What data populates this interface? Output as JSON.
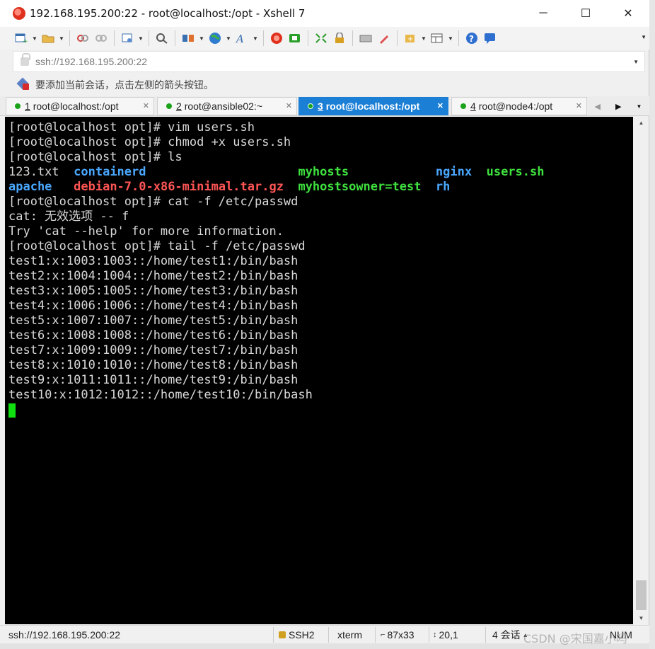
{
  "window": {
    "title": "192.168.195.200:22 - root@localhost:/opt - Xshell 7",
    "controls": {
      "minimize": "─",
      "maximize": "☐",
      "close": "✕"
    }
  },
  "toolbar": {
    "icons": [
      "new-session-icon",
      "open-folder-icon",
      "disconnect-icon",
      "reconnect-icon",
      "properties-icon",
      "find-icon",
      "transfer-icon",
      "globe-icon",
      "font-icon",
      "xshell-icon",
      "xftp-icon",
      "fullscreen-icon",
      "lock-icon",
      "keyboard-icon",
      "highlight-icon",
      "add-icon",
      "layout-icon",
      "help-icon",
      "chat-icon"
    ]
  },
  "address_bar": {
    "value": "ssh://192.168.195.200:22"
  },
  "hint_bar": {
    "text": "要添加当前会话，点击左侧的箭头按钮。"
  },
  "tabs": [
    {
      "number": "1",
      "label": "root@localhost:/opt",
      "active": false
    },
    {
      "number": "2",
      "label": "root@ansible02:~",
      "active": false
    },
    {
      "number": "3",
      "label": "root@localhost:/opt",
      "active": true
    },
    {
      "number": "4",
      "label": "root@node4:/opt",
      "active": false
    }
  ],
  "terminal": {
    "lines": [
      "[root@localhost opt]# vim users.sh",
      "[root@localhost opt]# chmod +x users.sh",
      "[root@localhost opt]# ls"
    ],
    "ls_row1": {
      "c1": "123.txt",
      "c2": "containerd",
      "c3": "myhosts",
      "c4": "nginx",
      "c5": "users.sh"
    },
    "ls_row2": {
      "c1": "apache",
      "c2": "debian-7.0-x86-minimal.tar.gz",
      "c3": "myhostsowner=test",
      "c4": "rh"
    },
    "lines2": [
      "[root@localhost opt]# cat -f /etc/passwd",
      "cat: 无效选项 -- f",
      "Try 'cat --help' for more information.",
      "[root@localhost opt]# tail -f /etc/passwd",
      "test1:x:1003:1003::/home/test1:/bin/bash",
      "test2:x:1004:1004::/home/test2:/bin/bash",
      "test3:x:1005:1005::/home/test3:/bin/bash",
      "test4:x:1006:1006::/home/test4:/bin/bash",
      "test5:x:1007:1007::/home/test5:/bin/bash",
      "test6:x:1008:1008::/home/test6:/bin/bash",
      "test7:x:1009:1009::/home/test7:/bin/bash",
      "test8:x:1010:1010::/home/test8:/bin/bash",
      "test9:x:1011:1011::/home/test9:/bin/bash",
      "test10:x:1012:1012::/home/test10:/bin/bash"
    ],
    "colors": {
      "directory": "#4aa8ff",
      "archive": "#ff5555",
      "executable": "#3ee03e",
      "cursor": "#10e010"
    }
  },
  "status_bar": {
    "connection": "ssh://192.168.195.200:22",
    "protocol": "SSH2",
    "terminal_type": "xterm",
    "size": "87x33",
    "cursor_pos": "20,1",
    "sessions": "4 会话",
    "caps": "NUM"
  },
  "watermark": "CSDN @宋国嘉小吗"
}
